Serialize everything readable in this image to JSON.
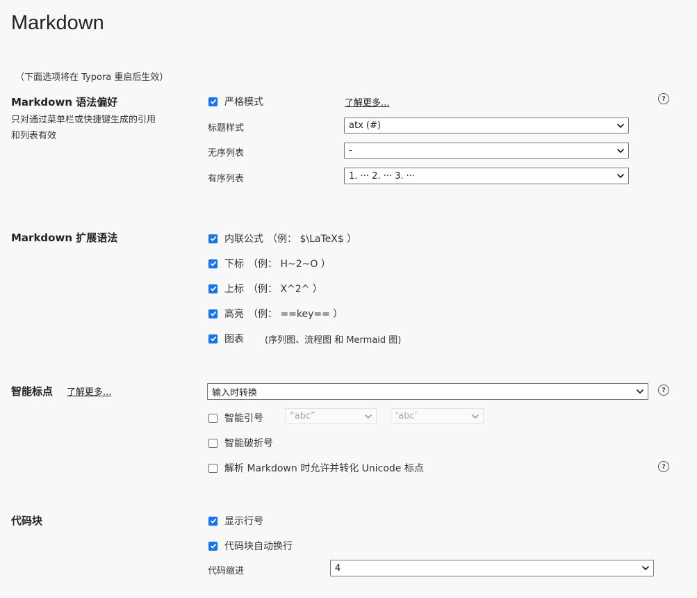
{
  "page": {
    "title": "Markdown",
    "restart_note": "（下面选项将在 Typora 重启后生效）"
  },
  "syntax_pref": {
    "heading": "Markdown 语法偏好",
    "description_line1": "只对通过菜单栏或快捷键生成的引用",
    "description_line2": "和列表有效",
    "strict_mode": {
      "label": "严格模式",
      "checked": true
    },
    "learn_more": "了解更多...",
    "heading_style": {
      "label": "标题样式",
      "value": "atx (#)"
    },
    "unordered_list": {
      "label": "无序列表",
      "value": "-"
    },
    "ordered_list": {
      "label": "有序列表",
      "value": "1. ··· 2. ··· 3. ···"
    }
  },
  "extended_syntax": {
    "heading": "Markdown 扩展语法",
    "items": [
      {
        "label": "内联公式",
        "example": "（例：  $\\LaTeX$ ）",
        "checked": true
      },
      {
        "label": "下标",
        "example": "（例：  H~2~O ）",
        "checked": true
      },
      {
        "label": "上标",
        "example": "（例：  X^2^ ）",
        "checked": true
      },
      {
        "label": "高亮",
        "example": "（例：  ==key== ）",
        "checked": true
      },
      {
        "label": "图表",
        "example": "(序列图、流程图 和 Mermaid 图)",
        "checked": true
      }
    ]
  },
  "smart_punct": {
    "heading": "智能标点",
    "learn_more": "了解更多...",
    "mode": {
      "value": "输入时转换"
    },
    "smart_quotes": {
      "label": "智能引号",
      "checked": false,
      "double_value": "“abc”",
      "single_value": "‘abc’"
    },
    "smart_dashes": {
      "label": "智能破折号",
      "checked": false
    },
    "unicode_punct": {
      "label": "解析 Markdown 时允许并转化 Unicode 标点",
      "checked": false
    }
  },
  "code_block": {
    "heading": "代码块",
    "show_line_numbers": {
      "label": "显示行号",
      "checked": true
    },
    "auto_wrap": {
      "label": "代码块自动换行",
      "checked": true
    },
    "indent": {
      "label": "代码缩进",
      "value": "4"
    }
  },
  "icons": {
    "help": "question-circle-icon",
    "checkbox_checked": "checkmark-icon",
    "dropdown": "chevron-down-icon"
  },
  "colors": {
    "accent": "#1a73e8",
    "background": "#f8f8f8"
  }
}
